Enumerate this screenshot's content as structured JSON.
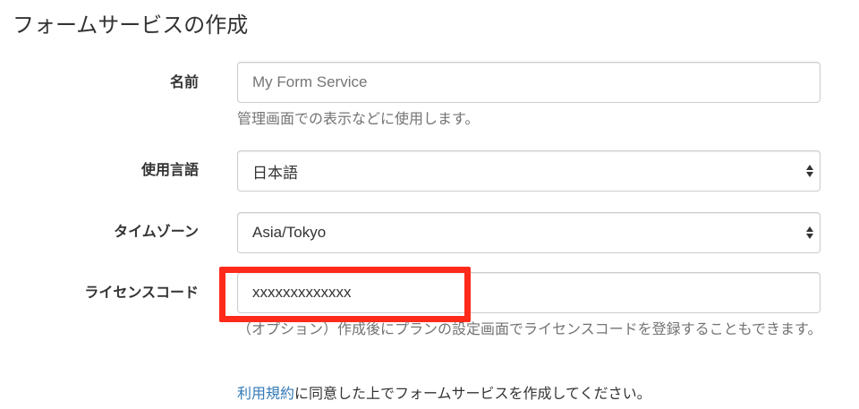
{
  "page": {
    "title": "フォームサービスの作成"
  },
  "form": {
    "name": {
      "label": "名前",
      "placeholder": "My Form Service",
      "help": "管理画面での表示などに使用します。"
    },
    "language": {
      "label": "使用言語",
      "selected": "日本語"
    },
    "timezone": {
      "label": "タイムゾーン",
      "selected": "Asia/Tokyo"
    },
    "license": {
      "label": "ライセンスコード",
      "value": "xxxxxxxxxxxxx",
      "help": "（オプション）作成後にプランの設定画面でライセンスコードを登録することもできます。"
    },
    "terms": {
      "link_text": "利用規約",
      "rest_text": "に同意した上でフォームサービスを作成してください。"
    }
  },
  "colors": {
    "highlight": "#ff2a1a",
    "link": "#337ab7"
  }
}
